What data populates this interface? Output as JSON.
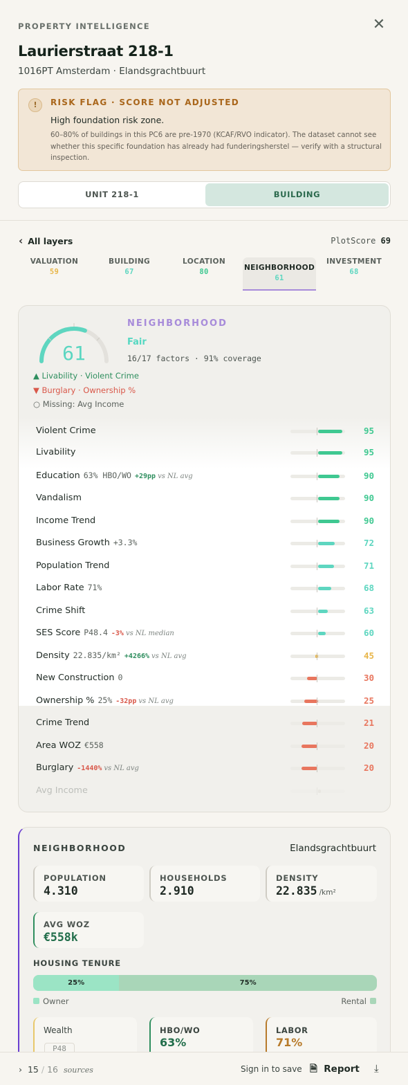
{
  "header": {
    "eyebrow": "PROPERTY INTELLIGENCE",
    "title": "Laurierstraat 218-1",
    "subtitle": "1016PT Amsterdam · Elandsgrachtbuurt"
  },
  "risk": {
    "title": "RISK FLAG · SCORE NOT ADJUSTED",
    "headline": "High foundation risk zone.",
    "body": "60–80% of buildings in this PC6 are pre-1970 (KCAF/RVO indicator). The dataset cannot see whether this specific foundation has already had funderingsherstel — verify with a structural inspection."
  },
  "toggle": {
    "unit": "UNIT 218-1",
    "building": "BUILDING"
  },
  "layers": {
    "back_label": "All layers",
    "plotscore_label": "PlotScore",
    "plotscore_value": "69",
    "tabs": [
      {
        "label": "VALUATION",
        "value": "59",
        "color": "#e8b64a"
      },
      {
        "label": "BUILDING",
        "value": "67",
        "color": "#5ed6c0"
      },
      {
        "label": "LOCATION",
        "value": "80",
        "color": "#3fc891"
      },
      {
        "label": "NEIGHBORHOOD",
        "value": "61",
        "color": "#5ed6c0"
      },
      {
        "label": "INVESTMENT",
        "value": "68",
        "color": "#5ed6c0"
      }
    ]
  },
  "neighborhood": {
    "eyebrow": "NEIGHBORHOOD",
    "score": "61",
    "rating": "Fair",
    "meta": "16/17 factors · 91% coverage",
    "strengths": "Livability · Violent Crime",
    "weaknesses": "Burglary · Ownership %",
    "missing": "Missing: Avg Income",
    "factors": [
      {
        "name": "Violent Crime",
        "score": "95",
        "pct": 0.95
      },
      {
        "name": "Livability",
        "score": "95",
        "pct": 0.95
      },
      {
        "name": "Education",
        "value": "63% HBO/WO",
        "delta": "+29pp",
        "cmp": "vs NL avg",
        "score": "90",
        "pct": 0.9
      },
      {
        "name": "Vandalism",
        "score": "90",
        "pct": 0.9
      },
      {
        "name": "Income Trend",
        "score": "90",
        "pct": 0.9
      },
      {
        "name": "Business Growth",
        "value": "+3.3%",
        "score": "72",
        "pct": 0.72
      },
      {
        "name": "Population Trend",
        "score": "71",
        "pct": 0.71
      },
      {
        "name": "Labor Rate",
        "value": "71%",
        "score": "68",
        "pct": 0.68
      },
      {
        "name": "Crime Shift",
        "score": "63",
        "pct": 0.63
      },
      {
        "name": "SES Score",
        "value": "P48.4",
        "delta": "-3%",
        "cmp": "vs NL median",
        "score": "60",
        "pct": 0.6
      },
      {
        "name": "Density",
        "value": "22.835/km²",
        "delta": "+4266%",
        "cmp": "vs NL avg",
        "score": "45",
        "pct": 0.45
      },
      {
        "name": "New Construction",
        "value": "0",
        "score": "30",
        "pct": 0.3
      },
      {
        "name": "Ownership %",
        "value": "25%",
        "delta": "-32pp",
        "cmp": "vs NL avg",
        "score": "25",
        "pct": 0.25
      },
      {
        "name": "Crime Trend",
        "score": "21",
        "pct": 0.21
      },
      {
        "name": "Area WOZ",
        "value": "€558",
        "score": "20",
        "pct": 0.2
      },
      {
        "name": "Burglary",
        "delta": "-1440%",
        "cmp": "vs NL avg",
        "score": "20",
        "pct": 0.2
      },
      {
        "name": "Avg Income",
        "score": "",
        "pct": 0.5,
        "faded": true
      }
    ]
  },
  "detail": {
    "eyebrow": "NEIGHBORHOOD",
    "area": "Elandsgrachtbuurt",
    "population_label": "POPULATION",
    "population": "4.310",
    "households_label": "HOUSEHOLDS",
    "households": "2.910",
    "density_label": "DENSITY",
    "density": "22.835",
    "density_unit": "/km²",
    "avg_woz_label": "AVG WOZ",
    "avg_woz": "€558k",
    "tenure_label": "HOUSING TENURE",
    "owner_pct": 25,
    "owner_text": "25%",
    "rental_text": "75%",
    "owner_label": "Owner",
    "rental_label": "Rental",
    "wealth_label": "Wealth",
    "wealth_chip": "P48",
    "hbo_label": "HBO/WO",
    "hbo_value": "63%",
    "labor_label": "LABOR",
    "labor_value": "71%"
  },
  "footer": {
    "sources_shown": "15",
    "sources_total": "16",
    "sources_label": "sources",
    "sign_in": "Sign in to save",
    "report": "Report"
  },
  "colors": {
    "high": "#3fc891",
    "mid": "#5ed6c0",
    "warn": "#e8b64a",
    "low": "#e8765e",
    "accent": "#a78bda"
  }
}
